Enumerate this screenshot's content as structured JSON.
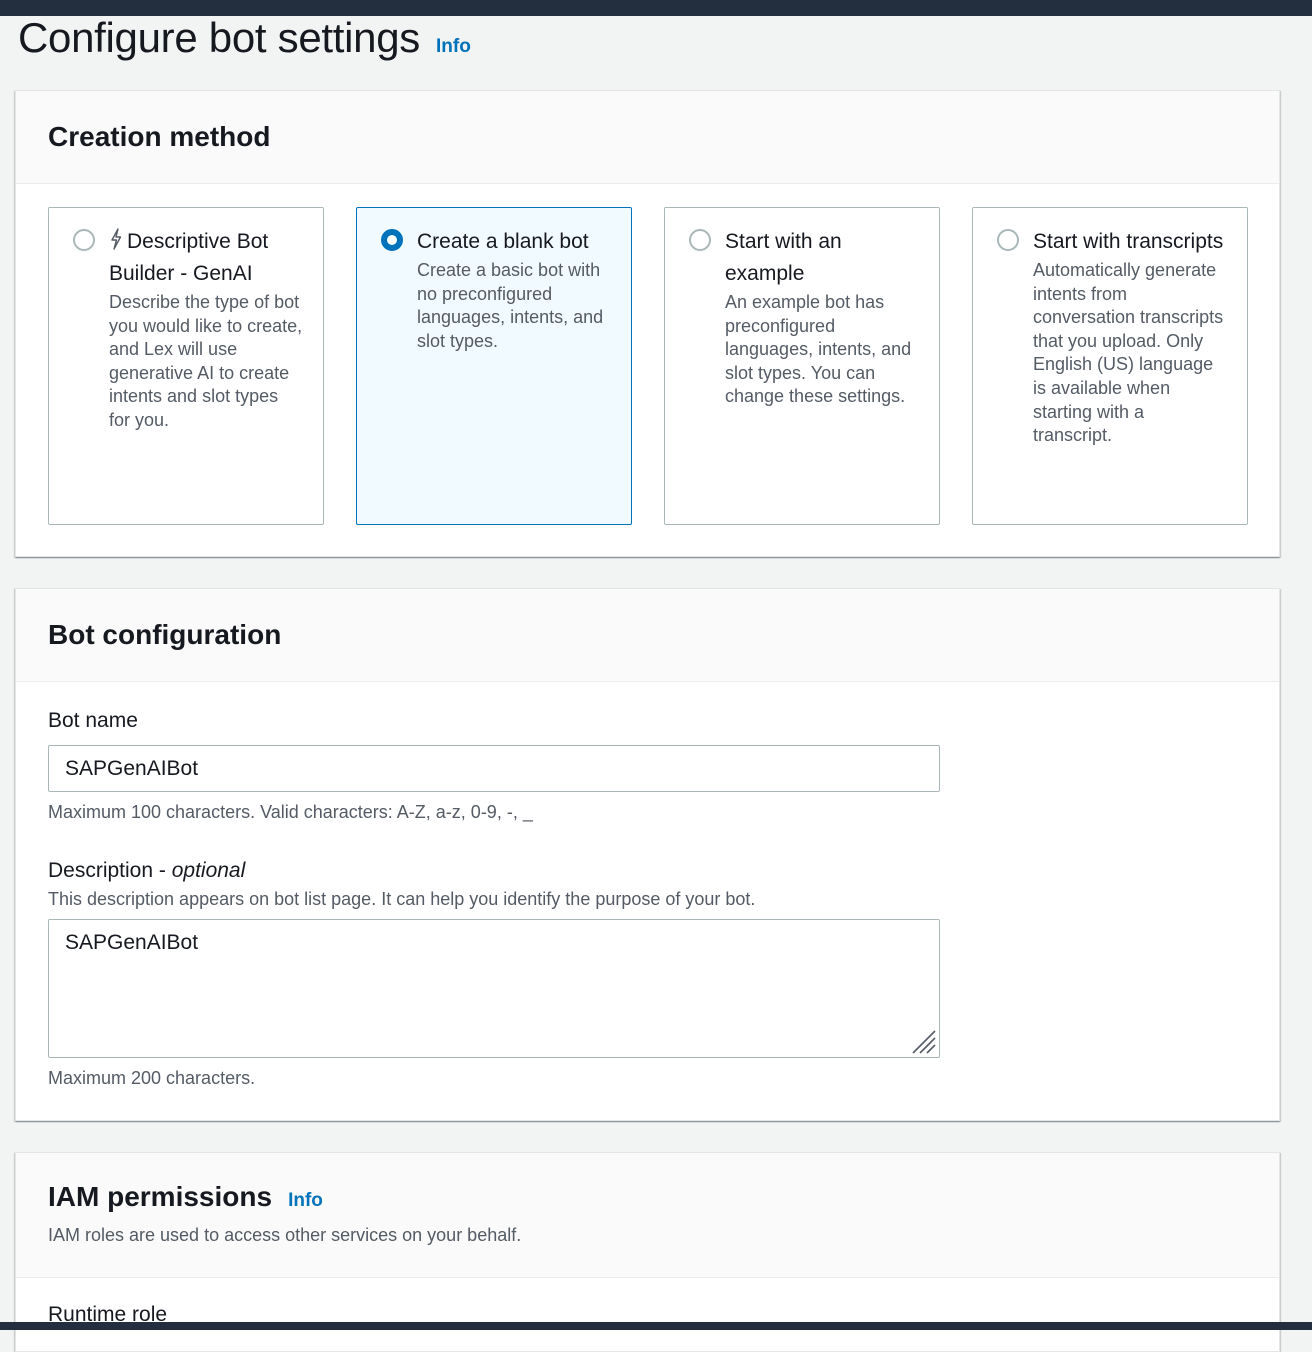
{
  "page": {
    "title": "Configure bot settings",
    "info_label": "Info"
  },
  "creation_method": {
    "title": "Creation method",
    "options": [
      {
        "label": "Descriptive Bot Builder - GenAI",
        "description": "Describe the type of bot you would like to create, and Lex will use generative AI to create intents and slot types for you.",
        "icon": "bolt-icon",
        "selected": false
      },
      {
        "label": "Create a blank bot",
        "description": "Create a basic bot with no preconfigured languages, intents, and slot types.",
        "selected": true
      },
      {
        "label": "Start with an example",
        "description": "An example bot has preconfigured languages, intents, and slot types. You can change these settings.",
        "selected": false
      },
      {
        "label": "Start with transcripts",
        "description": "Automatically generate intents from conversation transcripts that you upload. Only English (US) language is available when starting with a transcript.",
        "selected": false
      }
    ]
  },
  "bot_configuration": {
    "title": "Bot configuration",
    "bot_name": {
      "label": "Bot name",
      "value": "SAPGenAIBot",
      "constraint": "Maximum 100 characters. Valid characters: A-Z, a-z, 0-9, -, _"
    },
    "description": {
      "label": "Description",
      "label_suffix": "optional",
      "label_separator": " - ",
      "help": "This description appears on bot list page. It can help you identify the purpose of your bot.",
      "value": "SAPGenAIBot",
      "constraint": "Maximum 200 characters."
    }
  },
  "iam_permissions": {
    "title": "IAM permissions",
    "info_label": "Info",
    "description": "IAM roles are used to access other services on your behalf.",
    "runtime_role_label": "Runtime role"
  },
  "colors": {
    "accent": "#0073bb",
    "header_bar": "#232f3e",
    "selected_tile_bg": "#f1faff"
  }
}
